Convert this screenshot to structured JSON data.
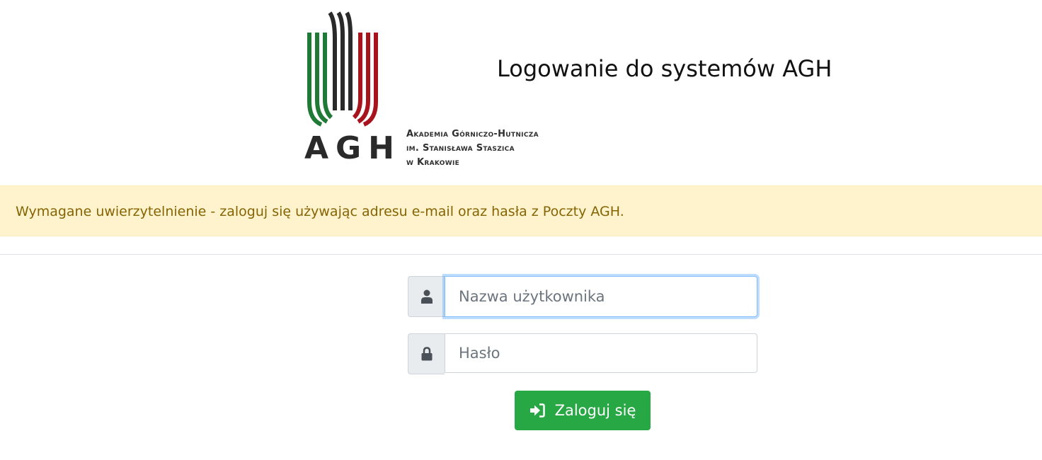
{
  "brand": {
    "logo_letters": "AGH",
    "logo_subtitle": [
      "Akademia Górniczo-Hutnicza",
      "im. Stanisława Staszica",
      "w Krakowie"
    ],
    "colors": {
      "green": "#1f7a35",
      "black": "#2a2a2a",
      "red": "#a8141e"
    }
  },
  "page": {
    "title": "Logowanie do systemów AGH"
  },
  "alert": {
    "message": "Wymagane uwierzytelnienie - zaloguj się używając adresu e-mail oraz hasła z Poczty AGH.",
    "background": "#fff3cd",
    "text_color": "#856404"
  },
  "form": {
    "username": {
      "placeholder": "Nazwa użytkownika",
      "value": "",
      "icon": "user-icon"
    },
    "password": {
      "placeholder": "Hasło",
      "value": "",
      "icon": "lock-icon"
    },
    "submit": {
      "label": "Zaloguj się",
      "icon": "sign-in-icon",
      "color": "#28a745"
    }
  }
}
